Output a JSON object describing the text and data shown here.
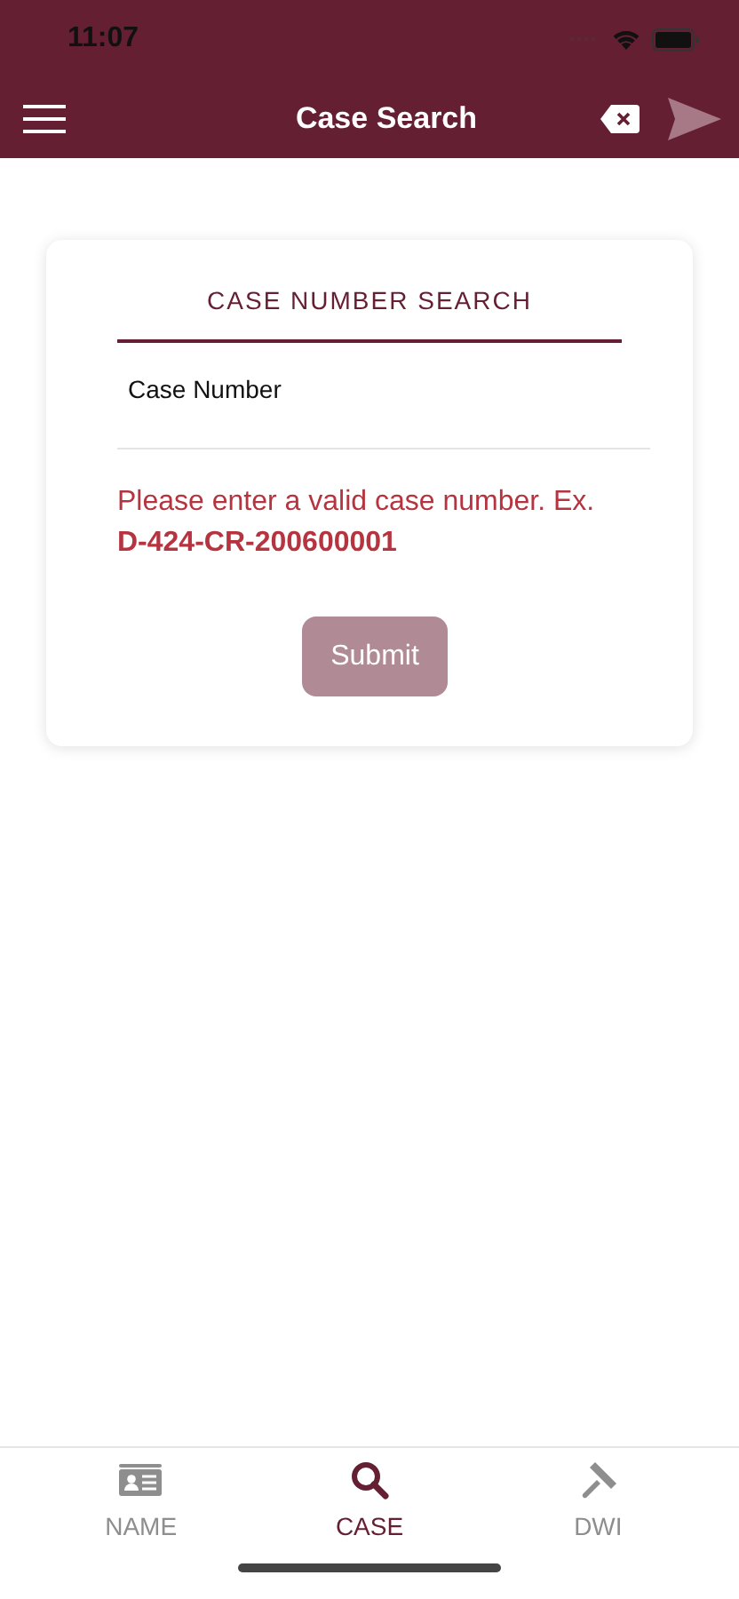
{
  "status_bar": {
    "time": "11:07"
  },
  "nav": {
    "title": "Case Search",
    "send_disabled": true
  },
  "card": {
    "heading": "CASE NUMBER SEARCH",
    "field": {
      "label": "Case Number"
    },
    "error": "Please enter a valid case number. Ex. **D-424-CR-200600001**",
    "submit": {
      "label": "Submit",
      "disabled": true
    }
  },
  "tabs": [
    {
      "label": "NAME",
      "kind": "id-card",
      "selected": false
    },
    {
      "label": "CASE",
      "kind": "search",
      "selected": true
    },
    {
      "label": "DWI",
      "kind": "gavel",
      "selected": false
    }
  ]
}
